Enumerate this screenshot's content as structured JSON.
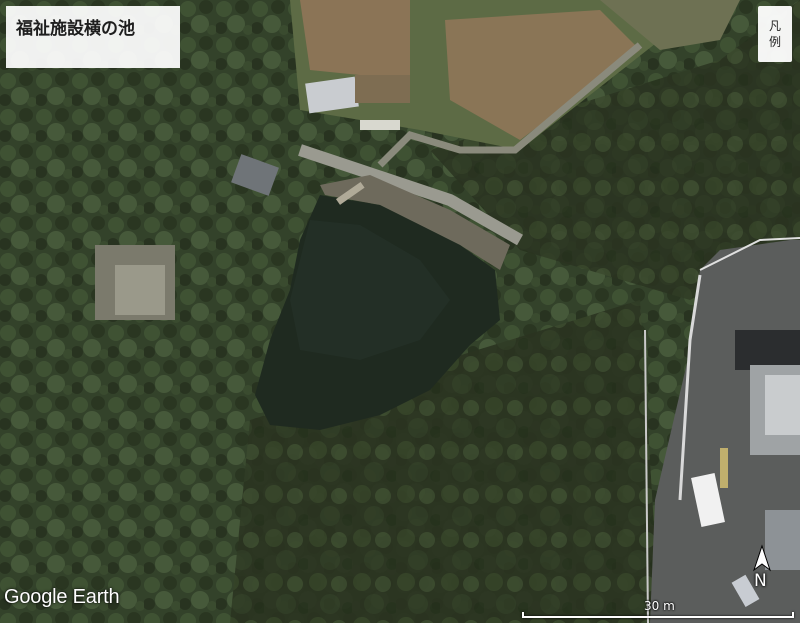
{
  "map": {
    "title": "福祉施設横の池",
    "legend_button": {
      "line1": "凡",
      "line2": "例"
    },
    "attribution": "Google Earth",
    "north_label": "N",
    "scale_label": "30 m",
    "view_type": "satellite imagery",
    "features": [
      "pond",
      "forest",
      "road",
      "building",
      "parking lot",
      "pier"
    ]
  }
}
